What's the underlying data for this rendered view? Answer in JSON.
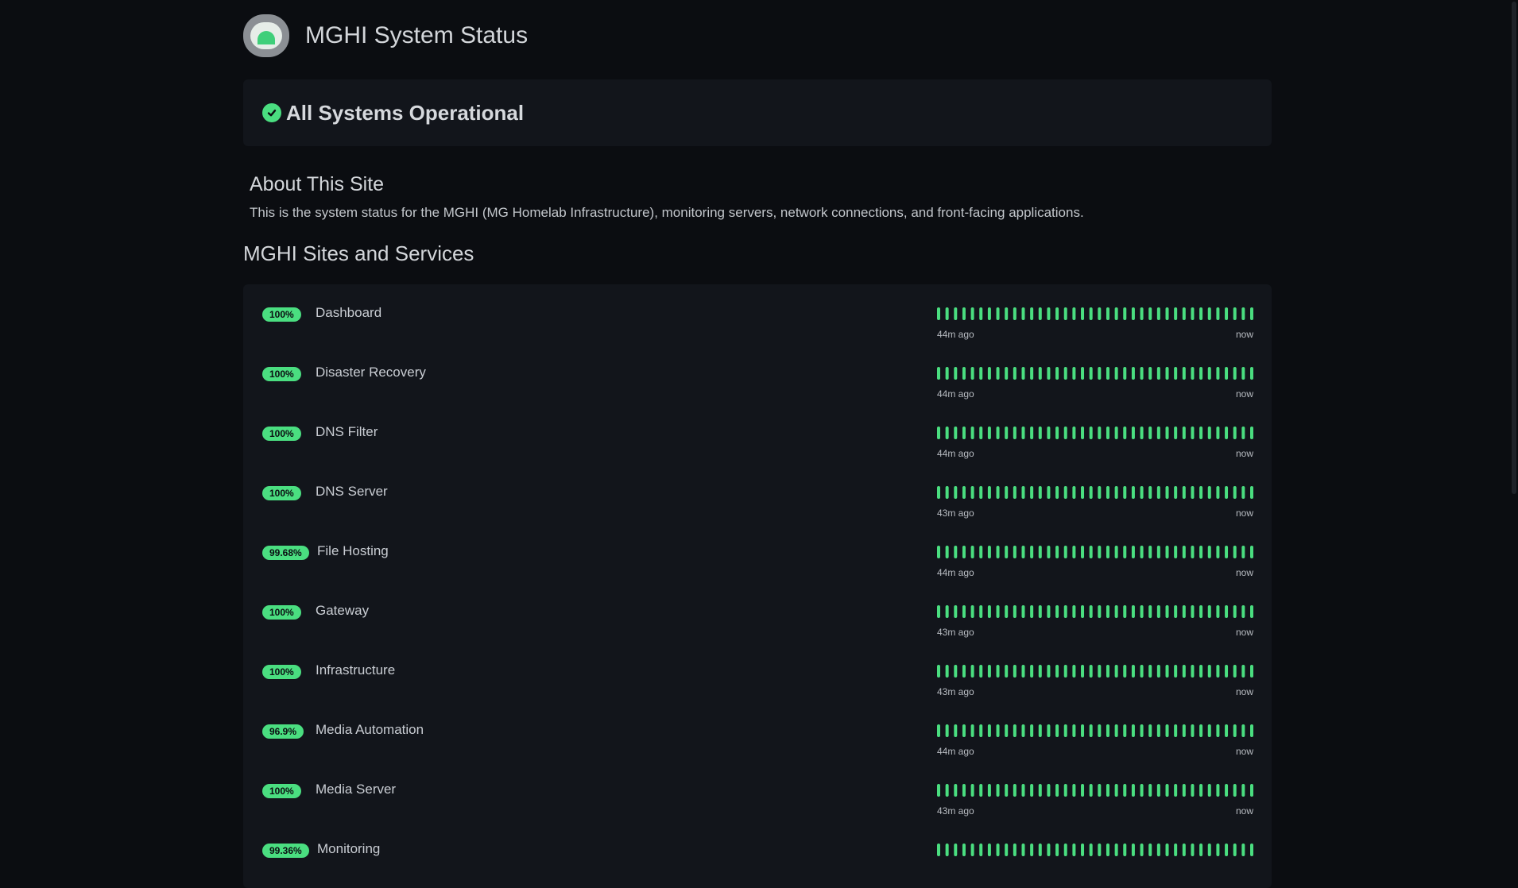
{
  "header": {
    "title": "MGHI System Status",
    "logo_icon": "dome-logo-icon"
  },
  "banner": {
    "text": "All Systems Operational",
    "icon": "check-circle-icon",
    "color": "#4ade80"
  },
  "about": {
    "title": "About This Site",
    "text": "This is the system status for the MGHI (MG Homelab Infrastructure), monitoring servers, network connections, and front-facing applications."
  },
  "services_section": {
    "title": "MGHI Sites and Services"
  },
  "colors": {
    "accent": "#4ade80",
    "background": "#0b0d11",
    "panel": "#12151b"
  },
  "services": [
    {
      "uptime": "100%",
      "name": "Dashboard",
      "since": "44m ago",
      "until": "now",
      "bars": 38
    },
    {
      "uptime": "100%",
      "name": "Disaster Recovery",
      "since": "44m ago",
      "until": "now",
      "bars": 38
    },
    {
      "uptime": "100%",
      "name": "DNS Filter",
      "since": "44m ago",
      "until": "now",
      "bars": 38
    },
    {
      "uptime": "100%",
      "name": "DNS Server",
      "since": "43m ago",
      "until": "now",
      "bars": 38
    },
    {
      "uptime": "99.68%",
      "name": "File Hosting",
      "since": "44m ago",
      "until": "now",
      "bars": 38
    },
    {
      "uptime": "100%",
      "name": "Gateway",
      "since": "43m ago",
      "until": "now",
      "bars": 38
    },
    {
      "uptime": "100%",
      "name": "Infrastructure",
      "since": "43m ago",
      "until": "now",
      "bars": 38
    },
    {
      "uptime": "96.9%",
      "name": "Media Automation",
      "since": "44m ago",
      "until": "now",
      "bars": 38
    },
    {
      "uptime": "100%",
      "name": "Media Server",
      "since": "43m ago",
      "until": "now",
      "bars": 38
    },
    {
      "uptime": "99.36%",
      "name": "Monitoring",
      "since": "",
      "until": "",
      "bars": 38
    }
  ]
}
